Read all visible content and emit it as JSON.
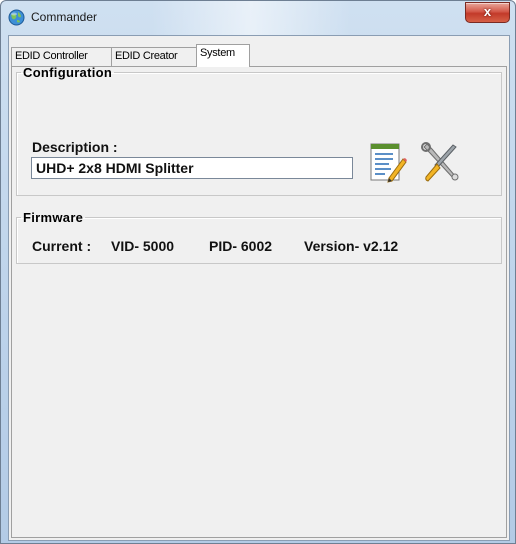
{
  "window": {
    "title": "Commander",
    "close_glyph": "x",
    "app_icon": "globe-icon"
  },
  "tabs": [
    {
      "label": "EDID Controller",
      "active": false
    },
    {
      "label": "EDID Creator",
      "active": false
    },
    {
      "label": "System",
      "active": true
    }
  ],
  "configuration": {
    "group_title": "Configuration",
    "description_label": "Description :",
    "description_value": "UHD+ 2x8 HDMI Splitter",
    "edit_button_icon": "document-edit-icon",
    "tools_button_icon": "tools-icon"
  },
  "firmware": {
    "group_title": "Firmware",
    "current_label": "Current :",
    "vid": "VID- 5000",
    "pid": "PID- 6002",
    "version": "Version- v2.12"
  },
  "colors": {
    "close_button": "#c8463a",
    "title_bar": "#bcd2ea",
    "panel_bg": "#f0f0f0"
  }
}
